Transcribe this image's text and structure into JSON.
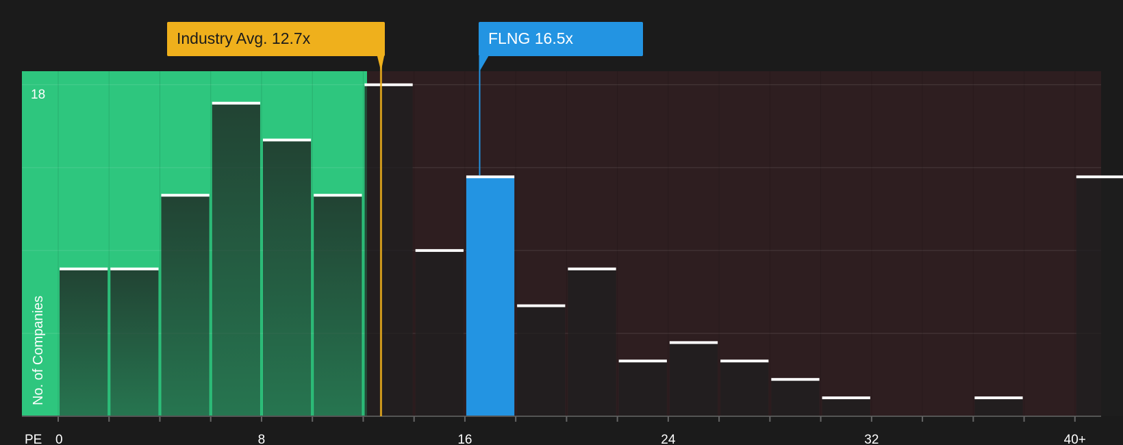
{
  "chart_data": {
    "type": "bar",
    "x_label": "PE",
    "y_label": "No. of Companies",
    "x_ticks": [
      "0",
      "8",
      "16",
      "24",
      "32",
      "40+"
    ],
    "y_ticks": [
      "18"
    ],
    "ylim": [
      0,
      18.7
    ],
    "bin_width": 2,
    "bin_starts": [
      0,
      2,
      4,
      6,
      8,
      10,
      12,
      14,
      16,
      18,
      20,
      22,
      24,
      26,
      28,
      30,
      32,
      34,
      36,
      38,
      40
    ],
    "values": [
      8,
      8,
      12,
      17,
      15,
      12,
      18,
      9,
      13,
      6,
      8,
      3,
      4,
      3,
      2,
      1,
      0,
      0,
      1,
      0,
      13
    ],
    "highlight_bin_start": 16,
    "industry_avg": 12.7,
    "company_value": 16.5,
    "grid": true,
    "colors": {
      "below_avg_bg": "#2ec67e",
      "above_avg_bg": "#2e1e20",
      "bar_fill": "#1f1f1f",
      "bar_cap": "#ffffff",
      "highlight": "#2394e2",
      "industry_marker": "#efb01c"
    }
  },
  "callouts": {
    "industry_label": "Industry Avg. 12.7x",
    "company_label": "FLNG 16.5x"
  }
}
